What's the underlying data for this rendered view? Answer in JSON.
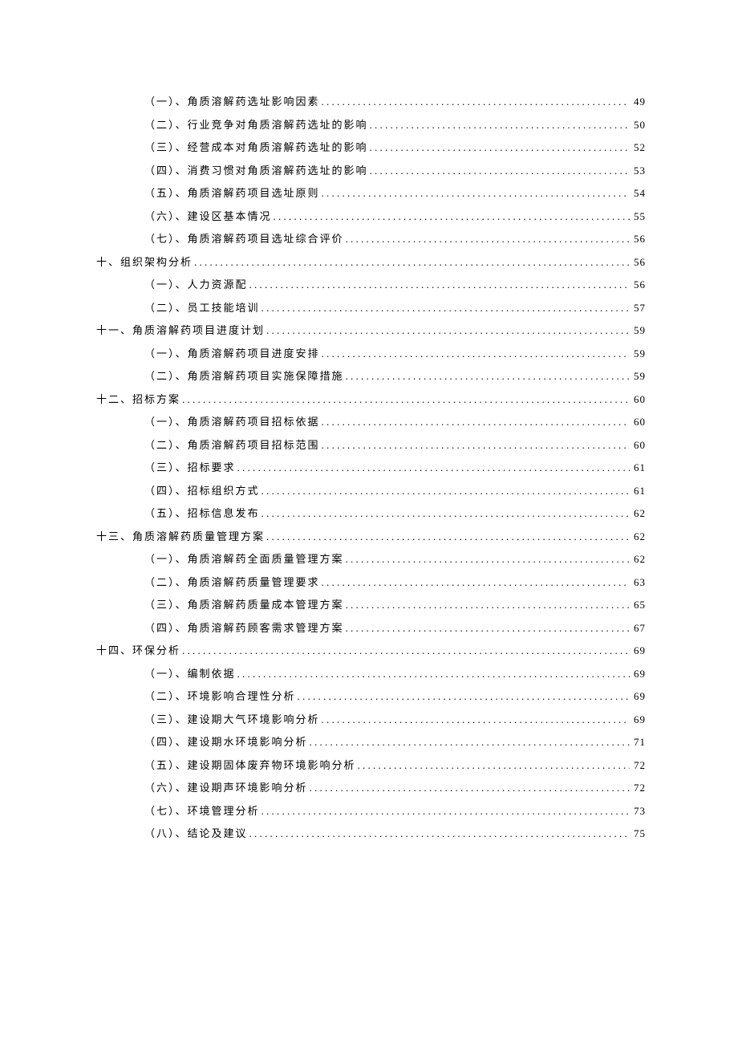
{
  "toc": [
    {
      "level": 2,
      "label": "（一）、角质溶解药选址影响因素",
      "page": "49"
    },
    {
      "level": 2,
      "label": "（二）、行业竞争对角质溶解药选址的影响",
      "page": "50"
    },
    {
      "level": 2,
      "label": "（三）、经营成本对角质溶解药选址的影响",
      "page": "52"
    },
    {
      "level": 2,
      "label": "（四）、消费习惯对角质溶解药选址的影响",
      "page": "53"
    },
    {
      "level": 2,
      "label": "（五）、角质溶解药项目选址原则",
      "page": "54"
    },
    {
      "level": 2,
      "label": "（六）、建设区基本情况",
      "page": "55"
    },
    {
      "level": 2,
      "label": "（七）、角质溶解药项目选址综合评价",
      "page": "56"
    },
    {
      "level": 1,
      "label": "十、组织架构分析",
      "page": "56"
    },
    {
      "level": 2,
      "label": "（一）、人力资源配",
      "page": "56"
    },
    {
      "level": 2,
      "label": "（二）、员工技能培训",
      "page": "57"
    },
    {
      "level": 1,
      "label": "十一、角质溶解药项目进度计划",
      "page": "59"
    },
    {
      "level": 2,
      "label": "（一）、角质溶解药项目进度安排",
      "page": "59"
    },
    {
      "level": 2,
      "label": "（二）、角质溶解药项目实施保障措施",
      "page": "59"
    },
    {
      "level": 1,
      "label": "十二、招标方案",
      "page": "60"
    },
    {
      "level": 2,
      "label": "（一）、角质溶解药项目招标依据",
      "page": "60"
    },
    {
      "level": 2,
      "label": "（二）、角质溶解药项目招标范围",
      "page": "60"
    },
    {
      "level": 2,
      "label": "（三）、招标要求",
      "page": "61"
    },
    {
      "level": 2,
      "label": "（四）、招标组织方式",
      "page": "61"
    },
    {
      "level": 2,
      "label": "（五）、招标信息发布",
      "page": "62"
    },
    {
      "level": 1,
      "label": "十三、角质溶解药质量管理方案",
      "page": "62"
    },
    {
      "level": 2,
      "label": "（一）、角质溶解药全面质量管理方案",
      "page": "62"
    },
    {
      "level": 2,
      "label": "（二）、角质溶解药质量管理要求",
      "page": "63"
    },
    {
      "level": 2,
      "label": "（三）、角质溶解药质量成本管理方案",
      "page": "65"
    },
    {
      "level": 2,
      "label": "（四）、角质溶解药顾客需求管理方案",
      "page": "67"
    },
    {
      "level": 1,
      "label": "十四、环保分析",
      "page": "69"
    },
    {
      "level": 2,
      "label": "（一）、编制依据",
      "page": "69"
    },
    {
      "level": 2,
      "label": "（二）、环境影响合理性分析",
      "page": "69"
    },
    {
      "level": 2,
      "label": "（三）、建设期大气环境影响分析",
      "page": "69"
    },
    {
      "level": 2,
      "label": "（四）、建设期水环境影响分析",
      "page": "71"
    },
    {
      "level": 2,
      "label": "（五）、建设期固体废弃物环境影响分析",
      "page": "72"
    },
    {
      "level": 2,
      "label": "（六）、建设期声环境影响分析",
      "page": "72"
    },
    {
      "level": 2,
      "label": "（七）、环境管理分析",
      "page": "73"
    },
    {
      "level": 2,
      "label": "（八）、结论及建议",
      "page": "75"
    }
  ]
}
